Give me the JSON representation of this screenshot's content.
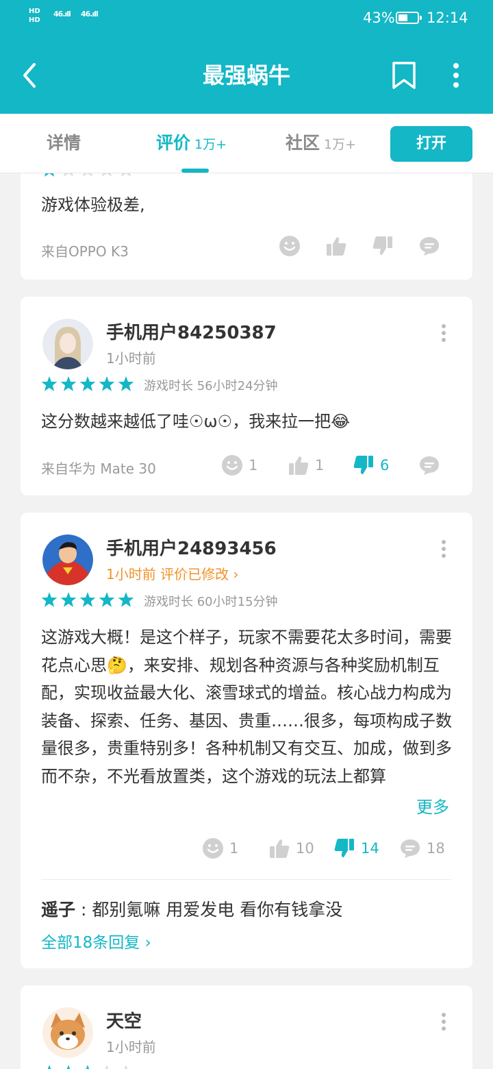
{
  "status_bar": {
    "hd1": "HD",
    "hd2": "HD",
    "signal1": "46",
    "signal2": "46",
    "battery": "43%",
    "time": "12:14"
  },
  "header": {
    "title": "最强蜗牛"
  },
  "tabs": [
    {
      "label": "详情",
      "count": ""
    },
    {
      "label": "评价",
      "count": "1万+"
    },
    {
      "label": "社区",
      "count": "1万+"
    }
  ],
  "open_button": "打开",
  "reviews": [
    {
      "rating": 1,
      "text": "游戏体验极差,",
      "device": "来自OPPO K3",
      "actions": {
        "happy": "",
        "like": "",
        "dislike": "",
        "comment": ""
      }
    },
    {
      "user": "手机用户84250387",
      "time": "1小时前",
      "rating": 5,
      "playtime": "游戏时长 56小时24分钟",
      "text": "这分数越来越低了哇☉ω☉，我来拉一把😂",
      "device": "来自华为 Mate 30",
      "actions": {
        "happy": "1",
        "like": "1",
        "dislike": "6",
        "comment": ""
      }
    },
    {
      "user": "手机用户24893456",
      "time": "1小时前 评价已修改 ›",
      "rating": 5,
      "playtime": "游戏时长 60小时15分钟",
      "text": "这游戏大概！是这个样子，玩家不需要花太多时间，需要花点心思🤔，来安排、规划各种资源与各种奖励机制互配，实现收益最大化、滚雪球式的增益。核心战力构成为装备、探索、任务、基因、贵重……很多，每项构成子数量很多，贵重特别多！各种机制又有交互、加成，做到多而不杂，不光看放置类，这个游戏的玩法上都算",
      "more": "更多",
      "actions": {
        "happy": "1",
        "like": "10",
        "dislike": "14",
        "comment": "18"
      },
      "reply": {
        "user": "遥子",
        "text": " : 都别氪嘛 用爱发电 看你有钱拿没"
      },
      "all_replies": "全部18条回复 ›"
    },
    {
      "user": "天空",
      "time": "1小时前",
      "rating": 3
    }
  ],
  "colors": {
    "accent": "#13b7c6",
    "orange": "#f0932b",
    "icon_grey": "#d0d0d0"
  }
}
